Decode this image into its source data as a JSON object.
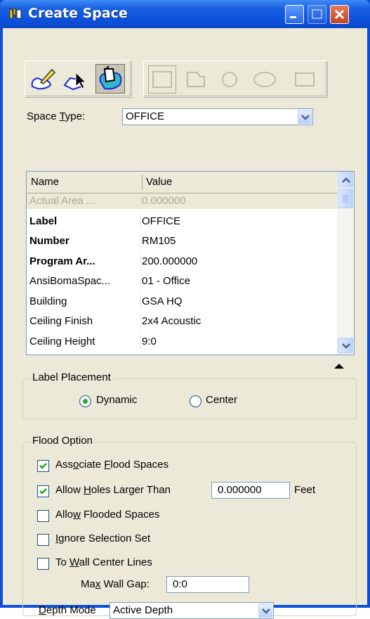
{
  "window": {
    "title": "Create Space"
  },
  "toolbar": {
    "method_tools": [
      "place-space-icon",
      "select-flood-icon",
      "flood-fill-icon"
    ],
    "active_method": "flood-fill-icon",
    "shape_tools": [
      "rectangle-icon",
      "polygon-icon",
      "circle-icon",
      "ellipse-icon",
      "square-icon"
    ]
  },
  "space_type": {
    "label_pre": "Space ",
    "label_u": "T",
    "label_post": "ype:",
    "value": "OFFICE"
  },
  "grid": {
    "col_name": "Name",
    "col_value": "Value",
    "rows": [
      {
        "name": "Actual Area ...",
        "value": "0.000000",
        "style": "disabled"
      },
      {
        "name": "Label",
        "value": "OFFICE",
        "style": "bold"
      },
      {
        "name": "Number",
        "value": "RM105",
        "style": "bold"
      },
      {
        "name": "Program Ar...",
        "value": "200.000000",
        "style": "bold"
      },
      {
        "name": "AnsiBomaSpac...",
        "value": "01 - Office",
        "style": "normal"
      },
      {
        "name": "Building",
        "value": "GSA HQ",
        "style": "normal"
      },
      {
        "name": "Ceiling Finish",
        "value": "2x4 Acoustic",
        "style": "normal"
      },
      {
        "name": "Ceiling Height",
        "value": "9:0",
        "style": "normal"
      }
    ]
  },
  "label_placement": {
    "legend": "Label Placement",
    "dynamic": "Dynamic",
    "center": "Center",
    "selected": "Dynamic"
  },
  "flood_option": {
    "legend": "Flood Option",
    "associate": {
      "pre": "Ass",
      "u": "o",
      "post": "ciate ",
      "u2": "F",
      "post2": "lood Spaces",
      "checked": true
    },
    "allow_holes": {
      "pre": "Allow ",
      "u": "H",
      "post": "oles Larger Than",
      "checked": true,
      "value": "0.000000",
      "unit": "Feet"
    },
    "allow_flooded": {
      "pre": "Allo",
      "u": "w",
      "post": " Flooded Spaces",
      "checked": false
    },
    "ignore_selection": {
      "pre": "",
      "u": "I",
      "post": "gnore Selection Set",
      "checked": false
    },
    "wall_center": {
      "pre": "To ",
      "u": "W",
      "post": "all Center Lines",
      "checked": false
    },
    "max_wall_gap": {
      "pre": "Ma",
      "u": "x",
      "post": " Wall Gap:",
      "value": "0:0"
    },
    "depth_mode": {
      "u": "D",
      "post": "epth Mode",
      "value": "Active Depth"
    }
  }
}
